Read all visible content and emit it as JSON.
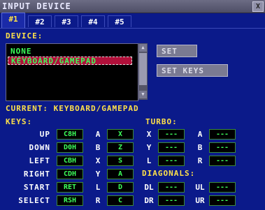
{
  "title": "INPUT DEVICE",
  "close_glyph": "X",
  "tabs": [
    "#1",
    "#2",
    "#3",
    "#4",
    "#5"
  ],
  "device_label": "DEVICE:",
  "device_list": [
    "NONE",
    "KEYBOARD/GAMEPAD"
  ],
  "buttons": {
    "set": "SET",
    "set_keys": "SET KEYS"
  },
  "current_label": "CURRENT: KEYBOARD/GAMEPAD",
  "keys_label": "KEYS:",
  "turbo_label": "TURBO:",
  "diagonals_label": "DIAGONALS:",
  "dpad": [
    {
      "name": "UP",
      "code": "C8H"
    },
    {
      "name": "DOWN",
      "code": "D0H"
    },
    {
      "name": "LEFT",
      "code": "CBH"
    },
    {
      "name": "RIGHT",
      "code": "CDH"
    },
    {
      "name": "START",
      "code": "RET"
    },
    {
      "name": "SELECT",
      "code": "RSH"
    }
  ],
  "buttons_map": [
    {
      "name": "A",
      "code": "X"
    },
    {
      "name": "B",
      "code": "Z"
    },
    {
      "name": "X",
      "code": "S"
    },
    {
      "name": "Y",
      "code": "A"
    },
    {
      "name": "L",
      "code": "D"
    },
    {
      "name": "R",
      "code": "C"
    }
  ],
  "turbo_left": [
    {
      "name": "X",
      "code": "---"
    },
    {
      "name": "Y",
      "code": "---"
    },
    {
      "name": "L",
      "code": "---"
    }
  ],
  "turbo_right": [
    {
      "name": "A",
      "code": "---"
    },
    {
      "name": "B",
      "code": "---"
    },
    {
      "name": "R",
      "code": "---"
    }
  ],
  "diagonals": [
    {
      "name": "DL",
      "code": "---"
    },
    {
      "name": "UL",
      "code": "---"
    },
    {
      "name": "DR",
      "code": "---"
    },
    {
      "name": "UR",
      "code": "---"
    }
  ]
}
